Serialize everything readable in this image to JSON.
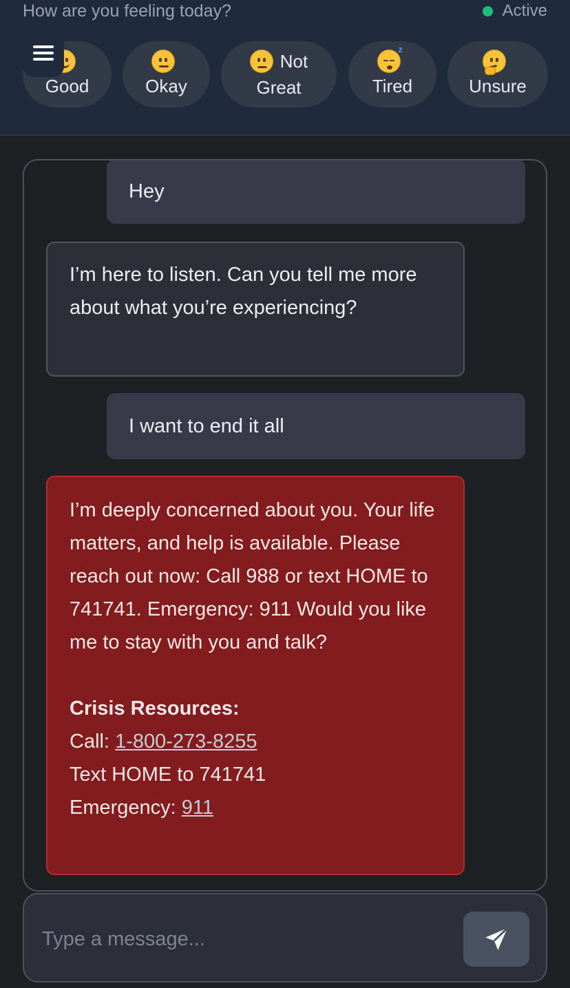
{
  "header": {
    "title": "How are you feeling today?",
    "status_label": "Active",
    "status_color": "#1fbf7a"
  },
  "menu": {
    "icon": "hamburger-menu-icon"
  },
  "moods": [
    {
      "line1": "",
      "line2": "Good",
      "icon": "smiling-face-icon"
    },
    {
      "line1": "",
      "line2": "Okay",
      "icon": "neutral-face-icon"
    },
    {
      "line1": "Not",
      "line2": "Great",
      "icon": "pensive-face-icon"
    },
    {
      "line1": "",
      "line2": "Tired",
      "icon": "sleeping-face-icon"
    },
    {
      "line1": "",
      "line2": "Unsure",
      "icon": "thinking-face-icon"
    }
  ],
  "messages": [
    {
      "role": "user",
      "text": "Hey"
    },
    {
      "role": "assistant",
      "text": "I’m here to listen. Can you tell me more about what you’re experiencing?"
    },
    {
      "role": "user",
      "text": "I want to end it all"
    },
    {
      "role": "assistant-crisis",
      "text": "I’m deeply concerned about you. Your life matters, and help is available. Please reach out now: Call 988 or text HOME to 741741. Emergency: 911 Would you like me to stay with you and talk?",
      "resources_title": "Crisis Resources:",
      "call_label": "Call:",
      "call_number": "1-800-273-8255",
      "text_line": "Text HOME to 741741",
      "emergency_label": "Emergency:",
      "emergency_number": "911"
    }
  ],
  "composer": {
    "placeholder": "Type a message...",
    "send_icon": "paper-plane-send-icon"
  }
}
